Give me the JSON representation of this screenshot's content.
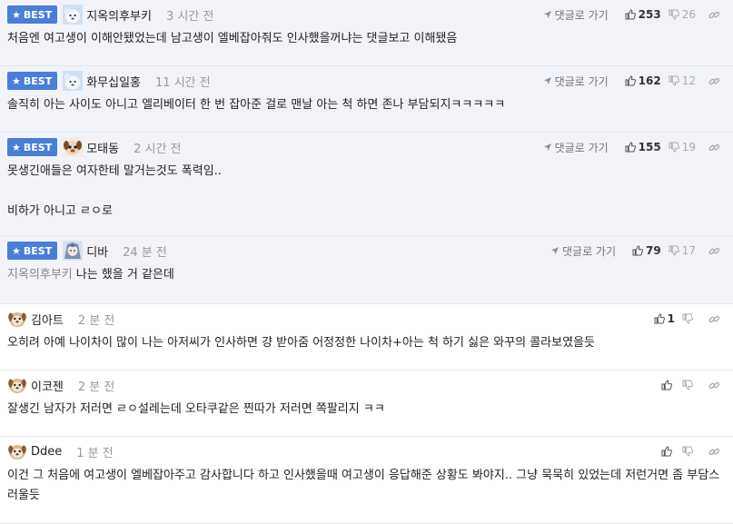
{
  "ui": {
    "best_label": "BEST",
    "reply_label": "댓글로 가기"
  },
  "comments": [
    {
      "best": true,
      "nick": "지옥의후부키",
      "time": "3 시간 전",
      "text": "처음엔 여고생이 이해안됐었는데 남고생이 엘베잡아줘도 인사했을꺼냐는 댓글보고 이해됐음",
      "mention": "",
      "up": "253",
      "down": "26",
      "avatar": "white-dog-avatar"
    },
    {
      "best": true,
      "nick": "화무십일홍",
      "time": "11 시간 전",
      "text": "솔직히 아는 사이도 아니고 엘리베이터 한 번 잡아준 걸로 맨날 아는 척 하면 존나 부담되지ㅋㅋㅋㅋㅋ",
      "mention": "",
      "up": "162",
      "down": "12",
      "avatar": "white-dog-avatar"
    },
    {
      "best": true,
      "nick": "모태동",
      "time": "2 시간 전",
      "text": "못생긴애들은 여자한테 말거는것도 폭력임..\n\n비하가 아니고 ㄹㅇ로",
      "mention": "",
      "up": "155",
      "down": "19",
      "avatar": "dog-face-avatar"
    },
    {
      "best": true,
      "nick": "디바",
      "time": "24 분 전",
      "text": "나는 했을 거 같은데",
      "mention": "지옥의후부키",
      "up": "79",
      "down": "17",
      "avatar": "anime-avatar"
    },
    {
      "best": false,
      "nick": "김아트",
      "time": "2 분 전",
      "text": "오히려 아예 나이차이 많이 나는 아저씨가 인사하면 걍 받아줌 어정정한 나이차+아는 척 하기 싫은 와꾸의 콜라보였을듯",
      "mention": "",
      "up": "1",
      "down": "",
      "avatar": "puppy-avatar"
    },
    {
      "best": false,
      "nick": "이코젠",
      "time": "2 분 전",
      "text": "잘생긴 남자가 저러면 ㄹㅇ설레는데 오타쿠같은 찐따가 저러면 쪽팔리지 ㅋㅋ",
      "mention": "",
      "up": "",
      "down": "",
      "avatar": "puppy-avatar"
    },
    {
      "best": false,
      "nick": "Ddee",
      "time": "1 분 전",
      "text": "이건 그 처음에 여고생이 엘베잡아주고 감사합니다 하고 인사했을때 여고생이 응답해준 상황도 봐야지.. 그냥 묵묵히 있었는데 저런거면 좀 부담스러울듯",
      "mention": "",
      "up": "",
      "down": "",
      "avatar": "puppy-avatar"
    }
  ],
  "colors": {
    "best_bg": "#f1f3f9",
    "badge": "#4a7fd4"
  }
}
